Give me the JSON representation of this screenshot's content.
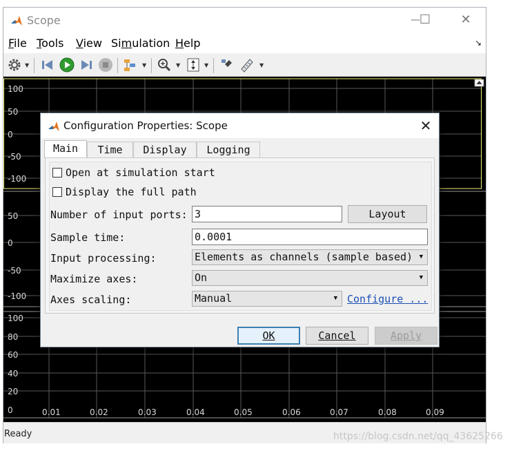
{
  "window": {
    "title": "Scope",
    "controls": {
      "minimize": "—",
      "maximize": "☐",
      "close": "✕"
    }
  },
  "menu": {
    "items": [
      {
        "label": "File",
        "accel": "F"
      },
      {
        "label": "Tools",
        "accel": "T"
      },
      {
        "label": "View",
        "accel": "V"
      },
      {
        "label": "Simulation",
        "accel": "m"
      },
      {
        "label": "Help",
        "accel": "H"
      }
    ]
  },
  "toolbar": {
    "icons": [
      "gear-icon",
      "step-back-icon",
      "run-icon",
      "step-forward-icon",
      "stop-icon",
      "signal-selector-icon",
      "zoom-icon",
      "scale-axes-icon",
      "highlight-block-icon",
      "measurements-icon"
    ]
  },
  "plot": {
    "background": "#000000",
    "grid_color": "#5a5a5a",
    "panel_border_color": "#f5f57a",
    "axes": [
      {
        "y_ticks": [
          "100",
          "50",
          "0",
          "-50",
          "-100"
        ]
      },
      {
        "y_ticks": [
          "50",
          "0",
          "-50",
          "-100"
        ]
      },
      {
        "y_ticks": [
          "100",
          "80",
          "60",
          "40",
          "20",
          "0"
        ],
        "x_ticks": [
          "0",
          "0.01",
          "0.02",
          "0.03",
          "0.04",
          "0.05",
          "0.06",
          "0.07",
          "0.08",
          "0.09"
        ]
      }
    ]
  },
  "status": {
    "text": "Ready"
  },
  "watermark": "https://blog.csdn.net/qq_43625266",
  "dialog": {
    "title": "Configuration Properties: Scope",
    "close_glyph": "✕",
    "tabs": [
      {
        "label": "Main",
        "active": true
      },
      {
        "label": "Time",
        "active": false
      },
      {
        "label": "Display",
        "active": false
      },
      {
        "label": "Logging",
        "active": false
      }
    ],
    "main": {
      "open_at_start": {
        "label": "Open at simulation start",
        "checked": false
      },
      "display_full_path": {
        "label": "Display the full path",
        "checked": false
      },
      "num_ports": {
        "label": "Number of input ports:",
        "value": "3"
      },
      "layout_button": "Layout",
      "sample_time": {
        "label": "Sample time:",
        "value": "0.0001"
      },
      "input_processing": {
        "label": "Input processing:",
        "value": "Elements as channels (sample based)"
      },
      "maximize_axes": {
        "label": "Maximize axes:",
        "value": "On"
      },
      "axes_scaling": {
        "label": "Axes scaling:",
        "value": "Manual"
      },
      "configure_link": "Configure ..."
    },
    "buttons": {
      "ok": "OK",
      "cancel": "Cancel",
      "apply": "Apply"
    }
  }
}
